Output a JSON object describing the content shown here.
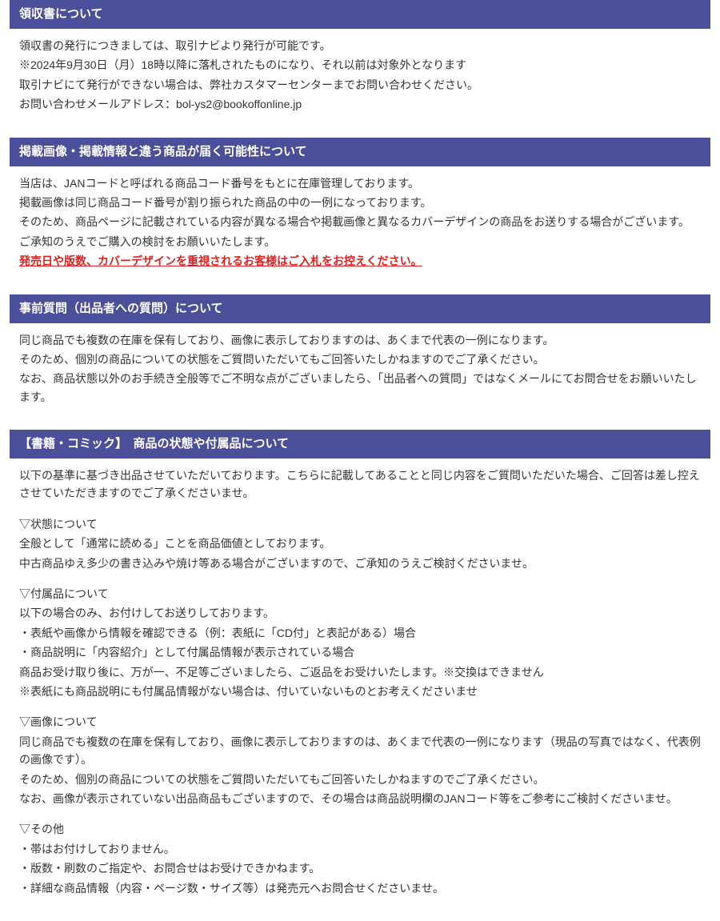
{
  "sections": [
    {
      "title": "領収書について",
      "paragraphs": [
        {
          "text": "領収書の発行につきましては、取引ナビより発行が可能です。"
        },
        {
          "text": "※2024年9月30日（月）18時以降に落札されたものになり、それ以前は対象外となります"
        },
        {
          "text": "取引ナビにて発行ができない場合は、弊社カスタマーセンターまでお問い合わせください。"
        },
        {
          "text": "お問い合わせメールアドレス：bol-ys2@bookoffonline.jp"
        }
      ]
    },
    {
      "title": "掲載画像・掲載情報と違う商品が届く可能性について",
      "paragraphs": [
        {
          "text": "当店は、JANコードと呼ばれる商品コード番号をもとに在庫管理しております。"
        },
        {
          "text": "掲載画像は同じ商品コード番号が割り振られた商品の中の一例になっております。"
        },
        {
          "text": "そのため、商品ページに記載されている内容が異なる場合や掲載画像と異なるカバーデザインの商品をお送りする場合がございます。"
        },
        {
          "text": "ご承知のうえでご購入の検討をお願いいたします。"
        },
        {
          "text": "発売日や版数、カバーデザインを重視されるお客様はご入札をお控えください。",
          "style": "red-underline"
        }
      ]
    },
    {
      "title": "事前質問（出品者への質問）について",
      "paragraphs": [
        {
          "text": "同じ商品でも複数の在庫を保有しており、画像に表示しておりますのは、あくまで代表の一例になります。"
        },
        {
          "text": "そのため、個別の商品についての状態をご質問いただいてもご回答いたしかねますのでご了承ください。"
        },
        {
          "text": "なお、商品状態以外のお手続き全般等でご不明な点がございましたら、「出品者への質問」ではなくメールにてお問合せをお願いいたします。"
        }
      ]
    },
    {
      "title": "【書籍・コミック】　商品の状態や付属品について",
      "paragraphs": [
        {
          "text": "以下の基準に基づき出品させていただいております。こちらに記載してあることと同じ内容をご質問いただいた場合、ご回答は差し控えさせていただきますのでご了承くださいませ。"
        },
        {
          "spacer": true
        },
        {
          "text": "▽状態について"
        },
        {
          "text": "全般として「通常に読める」ことを商品価値としております。"
        },
        {
          "text": "中古商品ゆえ多少の書き込みや焼け等ある場合がございますので、ご承知のうえご検討くださいませ。"
        },
        {
          "spacer": true
        },
        {
          "text": "▽付属品について"
        },
        {
          "text": "以下の場合のみ、お付けしてお送りしております。"
        },
        {
          "text": "・表紙や画像から情報を確認できる（例：表紙に「CD付」と表記がある）場合"
        },
        {
          "text": "・商品説明に「内容紹介」として付属品情報が表示されている場合"
        },
        {
          "text": "商品お受け取り後に、万が一、不足等ございましたら、ご返品をお受けいたします。※交換はできません"
        },
        {
          "text": "※表紙にも商品説明にも付属品情報がない場合は、付いていないものとお考えくださいませ"
        },
        {
          "spacer": true
        },
        {
          "text": "▽画像について"
        },
        {
          "text": "同じ商品でも複数の在庫を保有しており、画像に表示しておりますのは、あくまで代表の一例になります（現品の写真ではなく、代表例の画像です）。"
        },
        {
          "text": "そのため、個別の商品についての状態をご質問いただいてもご回答いたしかねますのでご了承ください。"
        },
        {
          "text": "なお、画像が表示されていない出品商品もございますので、その場合は商品説明欄のJANコード等をご参考にご検討くださいませ。"
        },
        {
          "spacer": true
        },
        {
          "text": "▽その他"
        },
        {
          "text": "・帯はお付けしておりません。"
        },
        {
          "text": "・版数・刷数のご指定や、お問合せはお受けできかねます。"
        },
        {
          "text": "・詳細な商品情報（内容・ページ数・サイズ等）は発売元へお問合せくださいませ。"
        }
      ]
    }
  ]
}
